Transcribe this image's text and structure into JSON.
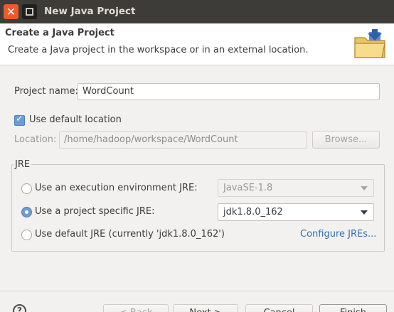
{
  "window": {
    "title": "New Java Project"
  },
  "header": {
    "title": "Create a Java Project",
    "description": "Create a Java project in the workspace or in an external location.",
    "icon": "folder-wizard-icon"
  },
  "project": {
    "name_label": "Project name:",
    "name_value": "WordCount"
  },
  "location": {
    "use_default_label": "Use default location",
    "use_default_checked": true,
    "label": "Location:",
    "value": "/home/hadoop/workspace/WordCount",
    "browse_label": "Browse..."
  },
  "jre": {
    "group_title": "JRE",
    "options": [
      {
        "label": "Use an execution environment JRE:",
        "selected": false,
        "combo_value": "JavaSE-1.8",
        "combo_enabled": false
      },
      {
        "label": "Use a project specific JRE:",
        "selected": true,
        "combo_value": "jdk1.8.0_162",
        "combo_enabled": true
      },
      {
        "label": "Use default JRE (currently 'jdk1.8.0_162')",
        "selected": false
      }
    ],
    "configure_link": "Configure JREs..."
  },
  "footer": {
    "help_icon": "help-icon",
    "back_label": "< Back",
    "next_label": "Next >",
    "cancel_label": "Cancel",
    "finish_label": "Finish"
  }
}
